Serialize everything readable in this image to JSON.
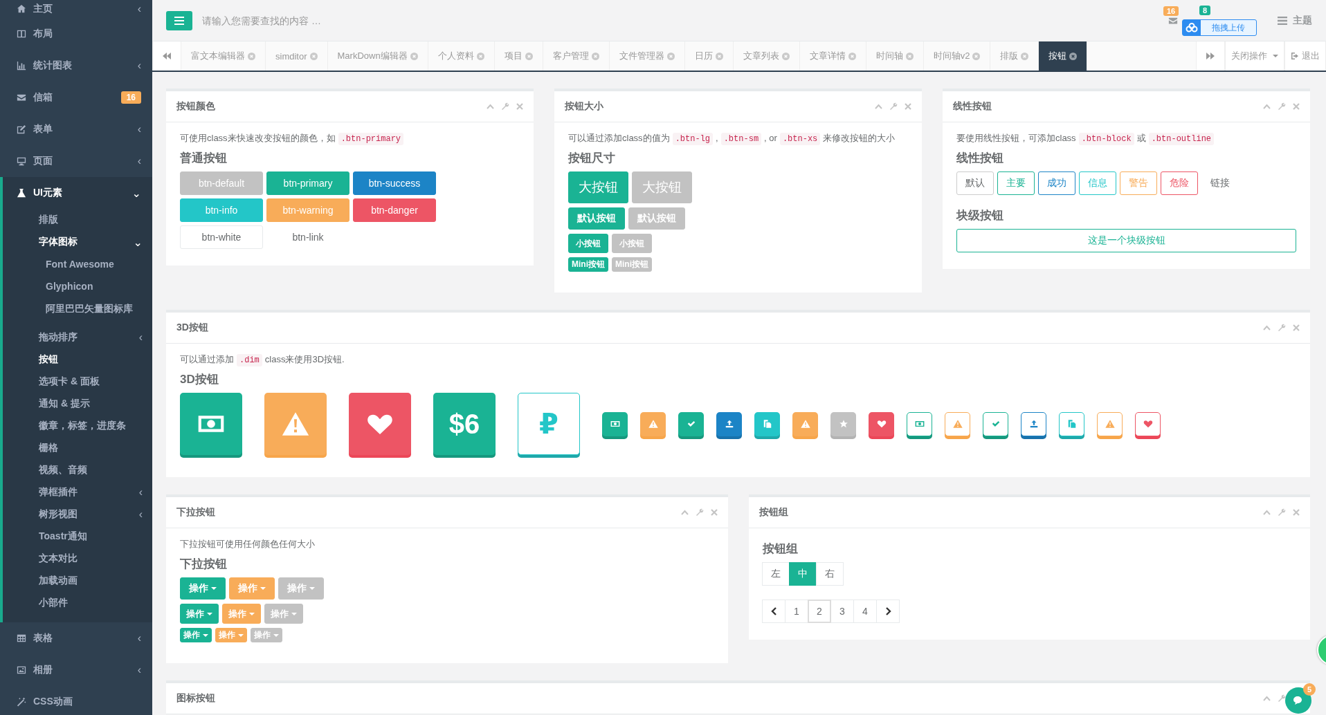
{
  "header": {
    "search_placeholder": "请输入您需要查找的内容 …",
    "mail_count": "16",
    "bell_count": "8",
    "upload_label": "拖拽上传",
    "theme_label": "主题"
  },
  "tabs": {
    "items": [
      {
        "label": "富文本编辑器",
        "selected": false
      },
      {
        "label": "simditor",
        "selected": false
      },
      {
        "label": "MarkDown编辑器",
        "selected": false
      },
      {
        "label": "个人资料",
        "selected": false
      },
      {
        "label": "项目",
        "selected": false
      },
      {
        "label": "客户管理",
        "selected": false
      },
      {
        "label": "文件管理器",
        "selected": false
      },
      {
        "label": "日历",
        "selected": false
      },
      {
        "label": "文章列表",
        "selected": false
      },
      {
        "label": "文章详情",
        "selected": false
      },
      {
        "label": "时间轴",
        "selected": false
      },
      {
        "label": "时间轴v2",
        "selected": false
      },
      {
        "label": "排版",
        "selected": false
      },
      {
        "label": "按钮",
        "selected": true
      }
    ],
    "close_menu": "关闭操作",
    "logout": "退出"
  },
  "sidebar": {
    "items": [
      {
        "label": "主页",
        "chevron": "‹",
        "selected": false
      },
      {
        "label": "布局",
        "selected": false
      },
      {
        "label": "统计图表",
        "chevron": "‹",
        "selected": false
      },
      {
        "label": "信箱",
        "selected": false,
        "badge": "16"
      },
      {
        "label": "表单",
        "chevron": "‹",
        "selected": false
      },
      {
        "label": "页面",
        "chevron": "‹",
        "selected": false
      },
      {
        "label": "UI元素",
        "chevron": "⌄",
        "selected": true,
        "children": [
          {
            "label": "排版",
            "selected": false
          },
          {
            "label": "字体图标",
            "chevron": "⌄",
            "selected": true,
            "children": [
              {
                "label": "Font Awesome"
              },
              {
                "label": "Glyphicon"
              },
              {
                "label": "阿里巴巴矢量图标库"
              }
            ]
          },
          {
            "label": "拖动排序",
            "chevron": "‹",
            "selected": false
          },
          {
            "label": "按钮",
            "selected": true
          },
          {
            "label": "选项卡 & 面板",
            "selected": false
          },
          {
            "label": "通知 & 提示",
            "selected": false
          },
          {
            "label": "徽章，标签，进度条",
            "selected": false
          },
          {
            "label": "栅格",
            "selected": false
          },
          {
            "label": "视频、音频",
            "selected": false
          },
          {
            "label": "弹框插件",
            "chevron": "‹",
            "selected": false
          },
          {
            "label": "树形视图",
            "chevron": "‹",
            "selected": false
          },
          {
            "label": "Toastr通知",
            "selected": false
          },
          {
            "label": "文本对比",
            "selected": false
          },
          {
            "label": "加载动画",
            "selected": false
          },
          {
            "label": "小部件",
            "selected": false
          }
        ]
      },
      {
        "label": "表格",
        "chevron": "‹",
        "selected": false
      },
      {
        "label": "相册",
        "chevron": "‹",
        "selected": false
      },
      {
        "label": "CSS动画",
        "selected": false
      }
    ]
  },
  "button_colors": {
    "title": "按钮颜色",
    "note": [
      {
        "kind": "text",
        "text": "可使用class来快速改变按钮的颜色，如"
      },
      {
        "kind": "code",
        "text": ".btn-primary"
      }
    ],
    "heading": "普通按钮",
    "buttons": [
      {
        "label": "btn-default",
        "kind": "default"
      },
      {
        "label": "btn-primary",
        "kind": "primary"
      },
      {
        "label": "btn-success",
        "kind": "success"
      },
      {
        "label": "btn-info",
        "kind": "info"
      },
      {
        "label": "btn-warning",
        "kind": "warning"
      },
      {
        "label": "btn-danger",
        "kind": "danger"
      },
      {
        "label": "btn-white",
        "kind": "white"
      },
      {
        "label": "btn-link",
        "kind": "link"
      }
    ]
  },
  "button_sizes": {
    "title": "按钮大小",
    "note": [
      {
        "kind": "text",
        "text": "可以通过添加class的值为"
      },
      {
        "kind": "code",
        "text": ".btn-lg"
      },
      {
        "kind": "text",
        "text": ","
      },
      {
        "kind": "code",
        "text": ".btn-sm"
      },
      {
        "kind": "text",
        "text": ", or"
      },
      {
        "kind": "code",
        "text": ".btn-xs"
      },
      {
        "kind": "text",
        "text": "来修改按钮的大小"
      }
    ],
    "heading": "按钮尺寸",
    "rows": [
      {
        "buttons": [
          {
            "label": "大按钮",
            "kind": "primary"
          },
          {
            "label": "大按钮",
            "kind": "default"
          }
        ]
      },
      {
        "buttons": [
          {
            "label": "默认按钮",
            "kind": "primary"
          },
          {
            "label": "默认按钮",
            "kind": "default"
          }
        ]
      },
      {
        "buttons": [
          {
            "label": "小按钮",
            "kind": "primary"
          },
          {
            "label": "小按钮",
            "kind": "default"
          }
        ]
      },
      {
        "buttons": [
          {
            "label": "Mini按钮",
            "kind": "primary"
          },
          {
            "label": "Mini按钮",
            "kind": "default"
          }
        ]
      }
    ]
  },
  "outline_buttons": {
    "title": "线性按钮",
    "note": [
      {
        "kind": "text",
        "text": "要使用线性按钮，可添加class"
      },
      {
        "kind": "code",
        "text": ".btn-block"
      },
      {
        "kind": "text",
        "text": "或"
      },
      {
        "kind": "code",
        "text": ".btn-outline"
      }
    ],
    "heading": "线性按钮",
    "buttons": [
      {
        "label": "默认",
        "kind": "default"
      },
      {
        "label": "主要",
        "kind": "primary"
      },
      {
        "label": "成功",
        "kind": "success"
      },
      {
        "label": "信息",
        "kind": "info"
      },
      {
        "label": "警告",
        "kind": "warning"
      },
      {
        "label": "危险",
        "kind": "danger"
      },
      {
        "label": "链接",
        "kind": "link"
      }
    ],
    "block_heading": "块级按钮",
    "block_button": "这是一个块级按钮"
  },
  "buttons_3d": {
    "title": "3D按钮",
    "note": [
      {
        "kind": "text",
        "text": "可以通过添加"
      },
      {
        "kind": "code",
        "text": ".dim"
      },
      {
        "kind": "text",
        "text": "class来使用3D按钮."
      }
    ],
    "heading": "3D按钮",
    "large": [
      {
        "kind": "primary"
      },
      {
        "kind": "warning"
      },
      {
        "kind": "danger"
      },
      {
        "kind": "primary",
        "text": "$6"
      }
    ],
    "large_outline": [
      {
        "kind": "info",
        "text": "₽"
      }
    ],
    "small": [
      {
        "kind": "primary"
      },
      {
        "kind": "warning"
      },
      {
        "kind": "primary"
      },
      {
        "kind": "success"
      },
      {
        "kind": "info"
      },
      {
        "kind": "warning"
      },
      {
        "kind": "default"
      },
      {
        "kind": "danger"
      }
    ],
    "small_outline": [
      {
        "kind": "primary"
      },
      {
        "kind": "warning"
      },
      {
        "kind": "primary"
      },
      {
        "kind": "success"
      },
      {
        "kind": "info"
      },
      {
        "kind": "warning"
      },
      {
        "kind": "danger"
      }
    ]
  },
  "dropdown_buttons": {
    "title": "下拉按钮",
    "note": [
      {
        "kind": "text",
        "text": "下拉按钮可使用任何颜色任何大小"
      }
    ],
    "heading": "下拉按钮",
    "rows": [
      {
        "buttons": [
          {
            "label": "操作",
            "kind": "primary"
          },
          {
            "label": "操作",
            "kind": "warning"
          },
          {
            "label": "操作",
            "kind": "default"
          }
        ]
      },
      {
        "buttons": [
          {
            "label": "操作",
            "kind": "primary"
          },
          {
            "label": "操作",
            "kind": "warning"
          },
          {
            "label": "操作",
            "kind": "default"
          }
        ]
      },
      {
        "buttons": [
          {
            "label": "操作",
            "kind": "primary"
          },
          {
            "label": "操作",
            "kind": "warning"
          },
          {
            "label": "操作",
            "kind": "default"
          }
        ]
      }
    ]
  },
  "button_group": {
    "title": "按钮组",
    "heading": "按钮组",
    "group": [
      {
        "label": "左",
        "selected": false
      },
      {
        "label": "中",
        "selected": true
      },
      {
        "label": "右",
        "selected": false
      }
    ],
    "pages": [
      {
        "label": "1",
        "selected": false
      },
      {
        "label": "2",
        "selected": true
      },
      {
        "label": "3",
        "selected": false
      },
      {
        "label": "4",
        "selected": false
      }
    ]
  },
  "icon_buttons": {
    "title": "图标按钮"
  },
  "chat": {
    "count": "5"
  }
}
